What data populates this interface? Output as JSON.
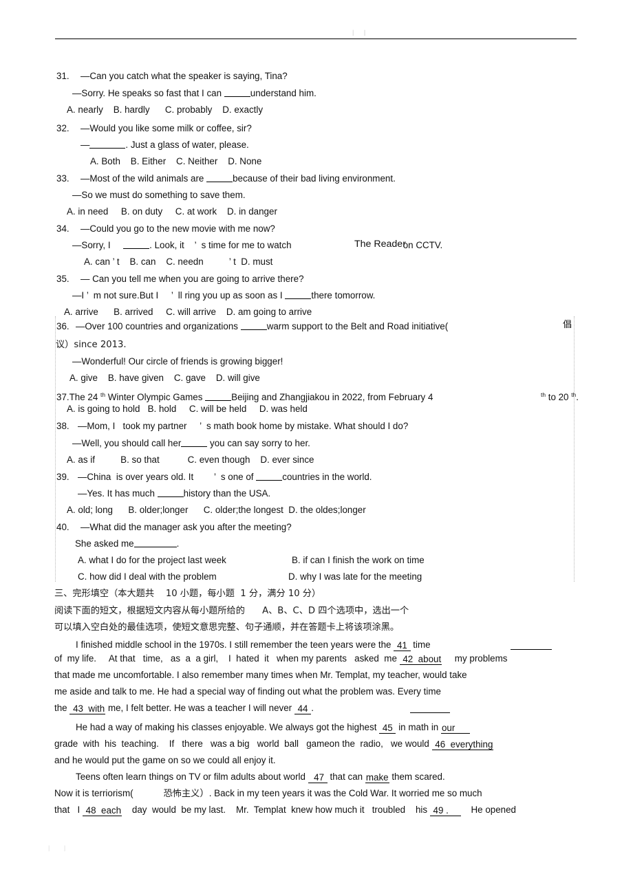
{
  "document": {
    "header_mark": "| |",
    "footer_mark": "| |"
  },
  "multiple_choice": {
    "q31": {
      "number": "31.",
      "line1": "—Can you catch what the speaker is saying, Tina?",
      "line2_a": "—Sorry. He speaks so fast that I can ",
      "line2_b": "understand him.",
      "options": "A. nearly    B. hardly      C. probably    D. exactly"
    },
    "q32": {
      "number": "32.",
      "line1": "—Would you like some milk or coffee, sir?",
      "line2_a": "—",
      "line2_b": ". Just a glass of water, please.",
      "options": "A. Both    B. Either    C. Neither    D. None"
    },
    "q33": {
      "number": "33.",
      "line1_a": "—Most of the wild animals are ",
      "line1_b": "because of their bad living environment.",
      "line2": "—So we must do something to save them.",
      "options": "A. in need     B. on duty     C. at work    D. in danger"
    },
    "q34": {
      "number": "34.",
      "line1": "—Could you go to the new movie with me now?",
      "line2_a": "—Sorry, I     ",
      "line2_b": ". Look, it    ’  s time for me to watch",
      "line2_title": "The Reader",
      "line2_tail": " on CCTV.",
      "options": "A. can ’ t    B. can    C. needn          ’ t  D. must"
    },
    "q35": {
      "number": "35.",
      "line1": "— Can you tell me when you are going to arrive there?",
      "line2_a": "—I ’  m not sure.But I     ’  ll ring you up as soon as I ",
      "line2_b": "there tomorrow.",
      "options": "A. arrive      B. arrived     C. will arrive    D. am going to arrive"
    },
    "q36": {
      "number": "36.",
      "line1_a": "—Over 100 countries and organizations ",
      "line1_b": "warm support to the Belt and Road initiative(",
      "line1_cn": "倡",
      "line2": "议）since 2013.",
      "line3": "—Wonderful! Our circle of friends is growing bigger!",
      "options": "A. give    B. have given    C. gave    D. will give"
    },
    "q37": {
      "number": "37.",
      "line1_a": "The 24 ",
      "line1_sup1": "th",
      "line1_b": " Winter Olympic Games ",
      "line1_c": "Beijing and Zhangjiakou in 2022, from February 4",
      "line1_sup2": "th",
      "line1_d": " to 20 ",
      "line1_sup3": "th",
      "line1_e": ".",
      "options": "A. is going to hold   B. hold     C. will be held     D. was held"
    },
    "q38": {
      "number": "38.",
      "line1": "—Mom, I   took my partner     ’  s math book home by mistake. What should I do?",
      "line2_a": "—Well, you should call her",
      "line2_b": " you can say sorry to her.",
      "options": "A. as if          B. so that           C. even though    D. ever since"
    },
    "q39": {
      "number": "39.",
      "line1_a": "—China  is over years old. It        ’  s one of ",
      "line1_b": "countries in the world.",
      "line2_a": "—Yes. It has much ",
      "line2_b": "history than the USA.",
      "options": "A. old; long      B. older;longer      C. older;the longest  D. the oldes;longer"
    },
    "q40": {
      "number": "40.",
      "line1": "—What did the manager ask you after the meeting?",
      "line2_a": "She asked me",
      "line2_b": ".",
      "option_a": "A. what I do for the project last week",
      "option_b": "B. if can I finish the work on time",
      "option_c": "C. how did I deal with the problem",
      "option_d": "D. why I was late for the meeting"
    }
  },
  "cloze": {
    "heading": "三、完形填空（本大题共    10 小题，每小题  1 分，满分 10 分）",
    "instruction_line1": "阅读下面的短文，根据短文内容从每小题所给的      A、B、C、D 四个选项中，选出一个",
    "instruction_line2": "可以填入空白处的最佳选项，使短文意思完整、句子通顺，并在答题卡上将该项涂黑。",
    "passage": {
      "p1_l1_a": "I finished middle school in the 1970s. I still remember the teen years were the ",
      "p1_l1_blank": " 41 ",
      "p1_l1_b": " time",
      "p1_l2_a": "of  my life.     At that   time,   as  a  a girl,    I  hated  it   when my parents   asked  me ",
      "p1_l2_blank": " 42  about",
      "p1_l2_b": "     my problems",
      "p1_l3": "that made me uncomfortable. I also remember many times when Mr. Templat, my teacher, would take",
      "p1_l4": "me aside and talk to me. He had a special way of finding out what the problem was. Every time",
      "p1_l5_a": "the ",
      "p1_l5_blank1": " 43  with",
      "p1_l5_b": " me, I felt better. He was a teacher I will never ",
      "p1_l5_blank2": " 44 ",
      "p1_l5_c": ".",
      "p2_l1_a": "He had a way of making his classes enjoyable. We always got the highest ",
      "p2_l1_blank": " 45 ",
      "p2_l1_b": " in math in ",
      "p2_l1_our": "our",
      "p2_l2_a": "grade  with  his  teaching.    If   there   was a big   world  ball   gameon the  radio,   we would ",
      "p2_l2_blank": " 46  everything",
      "p2_l3": "and he would put the game on so we could all enjoy it.",
      "p3_l1_a": "Teens often learn things on TV or film adults about world ",
      "p3_l1_blank": "  47 ",
      "p3_l1_b": " that can ",
      "p3_l1_make": "make",
      "p3_l1_c": " them scared.",
      "p3_l2_a": "Now it is terriorism(",
      "p3_l2_cn": "恐怖主义",
      "p3_l2_b": "）. Back in my teen years it was the Cold War. It worried me so much",
      "p3_l3_a": "that   I ",
      "p3_l3_blank1": " 48  each",
      "p3_l3_b": "    day  would  be my last.    Mr.  Templat  knew how much it   troubled    his ",
      "p3_l3_blank2": " 49 . ",
      "p3_l3_c": "    He opened"
    }
  }
}
